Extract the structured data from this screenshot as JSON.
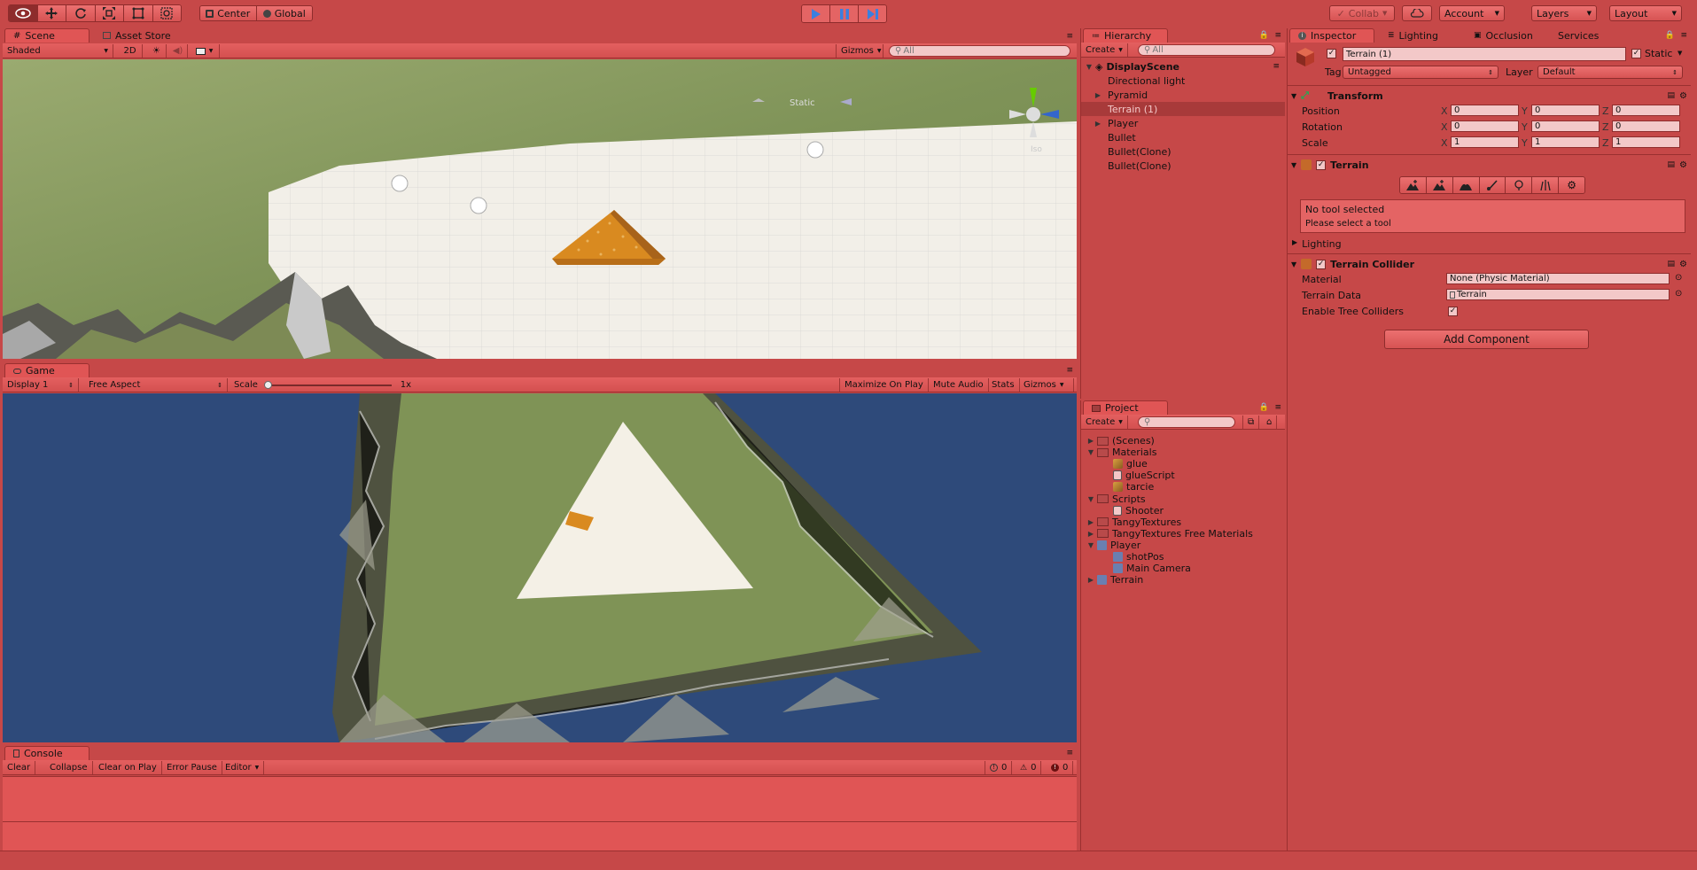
{
  "toolbar": {
    "tools": [
      "hand-tool",
      "move-tool",
      "rotate-tool",
      "scale-tool",
      "rect-tool",
      "transform-tool"
    ],
    "pivot": "Center",
    "space": "Global",
    "collab": "Collab",
    "account": "Account",
    "layers": "Layers",
    "layout": "Layout"
  },
  "scene": {
    "tab": "Scene",
    "tab2": "Asset Store",
    "shading": "Shaded",
    "mode2d": "2D",
    "gizmos": "Gizmos",
    "search": "All",
    "static_label": "Static",
    "gizmo_label": "Iso"
  },
  "game": {
    "tab": "Game",
    "display": "Display 1",
    "aspect": "Free Aspect",
    "scale_label": "Scale",
    "scale_value": "1x",
    "maximize": "Maximize On Play",
    "mute": "Mute Audio",
    "stats": "Stats",
    "gizmos": "Gizmos"
  },
  "console": {
    "tab": "Console",
    "clear": "Clear",
    "collapse": "Collapse",
    "clear_on_play": "Clear on Play",
    "error_pause": "Error Pause",
    "editor": "Editor",
    "info_count": "0",
    "warn_count": "0",
    "error_count": "0"
  },
  "hierarchy": {
    "tab": "Hierarchy",
    "create": "Create",
    "search": "All",
    "scene": "DisplayScene",
    "items": [
      {
        "label": "Directional light",
        "expandable": false,
        "selected": false
      },
      {
        "label": "Pyramid",
        "expandable": true,
        "selected": false
      },
      {
        "label": "Terrain (1)",
        "expandable": false,
        "selected": true
      },
      {
        "label": "Player",
        "expandable": true,
        "selected": false
      },
      {
        "label": "Bullet",
        "expandable": false,
        "selected": false
      },
      {
        "label": "Bullet(Clone)",
        "expandable": false,
        "selected": false
      },
      {
        "label": "Bullet(Clone)",
        "expandable": false,
        "selected": false
      }
    ]
  },
  "project": {
    "tab": "Project",
    "create": "Create",
    "items": [
      {
        "label": "(Scenes)",
        "depth": 0,
        "kind": "folder",
        "arrow": "closed"
      },
      {
        "label": "Materials",
        "depth": 0,
        "kind": "folder",
        "arrow": "open"
      },
      {
        "label": "glue",
        "depth": 1,
        "kind": "material",
        "arrow": ""
      },
      {
        "label": "glueScript",
        "depth": 1,
        "kind": "script",
        "arrow": ""
      },
      {
        "label": "tarcie",
        "depth": 1,
        "kind": "material",
        "arrow": ""
      },
      {
        "label": "Scripts",
        "depth": 0,
        "kind": "folder",
        "arrow": "open"
      },
      {
        "label": "Shooter",
        "depth": 1,
        "kind": "script",
        "arrow": ""
      },
      {
        "label": "TangyTextures",
        "depth": 0,
        "kind": "folder",
        "arrow": "closed"
      },
      {
        "label": "TangyTextures Free Materials",
        "depth": 0,
        "kind": "folder",
        "arrow": "closed"
      },
      {
        "label": "Player",
        "depth": 0,
        "kind": "prefab",
        "arrow": "open"
      },
      {
        "label": "shotPos",
        "depth": 1,
        "kind": "prefab",
        "arrow": ""
      },
      {
        "label": "Main Camera",
        "depth": 1,
        "kind": "prefab",
        "arrow": ""
      },
      {
        "label": "Terrain",
        "depth": 0,
        "kind": "prefab",
        "arrow": "closed"
      }
    ]
  },
  "inspector": {
    "tabs": [
      "Inspector",
      "Lighting",
      "Occlusion",
      "Services"
    ],
    "object_name": "Terrain (1)",
    "static": "Static",
    "tag_label": "Tag",
    "tag_value": "Untagged",
    "layer_label": "Layer",
    "layer_value": "Default",
    "transform": {
      "title": "Transform",
      "rows": [
        {
          "label": "Position",
          "x": "0",
          "y": "0",
          "z": "0"
        },
        {
          "label": "Rotation",
          "x": "0",
          "y": "0",
          "z": "0"
        },
        {
          "label": "Scale",
          "x": "1",
          "y": "1",
          "z": "1"
        }
      ]
    },
    "terrain": {
      "title": "Terrain",
      "no_tool": "No tool selected",
      "hint": "Please select a tool",
      "lighting": "Lighting"
    },
    "collider": {
      "title": "Terrain Collider",
      "material_label": "Material",
      "material_value": "None (Physic Material)",
      "data_label": "Terrain Data",
      "data_value": "Terrain",
      "trees_label": "Enable Tree Colliders"
    },
    "add_component": "Add Component"
  },
  "colors": {
    "editor_tint": "#c64848",
    "play_active": "#3a7fe0",
    "sky_game": "#2e4a7a",
    "grass": "#8a9c62",
    "sand": "#f2efe8",
    "pyramid": "#d98a20"
  }
}
